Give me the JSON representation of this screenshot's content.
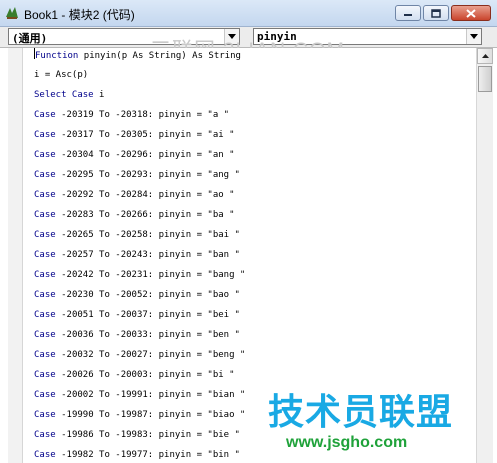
{
  "window": {
    "title": "Book1 - 模块2 (代码)"
  },
  "toolbar": {
    "object_value": "(通用)",
    "procedure_value": "pinyin"
  },
  "watermarks": {
    "top": "三联网 3LIAN.COM",
    "brand_cn": "技术员联盟",
    "brand_url": "www.jsgho.com"
  },
  "code": {
    "lines": [
      {
        "pre": "",
        "kw": "Function",
        "post": " pinyin(p As String) As String"
      },
      {
        "pre": "",
        "kw": "",
        "post": "i = Asc(p)"
      },
      {
        "pre": "",
        "kw": "Select Case",
        "post": " i"
      },
      {
        "pre": "",
        "kw": "Case",
        "post": " -20319 To -20318: pinyin = \"a \""
      },
      {
        "pre": "",
        "kw": "Case",
        "post": " -20317 To -20305: pinyin = \"ai \""
      },
      {
        "pre": "",
        "kw": "Case",
        "post": " -20304 To -20296: pinyin = \"an \""
      },
      {
        "pre": "",
        "kw": "Case",
        "post": " -20295 To -20293: pinyin = \"ang \""
      },
      {
        "pre": "",
        "kw": "Case",
        "post": " -20292 To -20284: pinyin = \"ao \""
      },
      {
        "pre": "",
        "kw": "Case",
        "post": " -20283 To -20266: pinyin = \"ba \""
      },
      {
        "pre": "",
        "kw": "Case",
        "post": " -20265 To -20258: pinyin = \"bai \""
      },
      {
        "pre": "",
        "kw": "Case",
        "post": " -20257 To -20243: pinyin = \"ban \""
      },
      {
        "pre": "",
        "kw": "Case",
        "post": " -20242 To -20231: pinyin = \"bang \""
      },
      {
        "pre": "",
        "kw": "Case",
        "post": " -20230 To -20052: pinyin = \"bao \""
      },
      {
        "pre": "",
        "kw": "Case",
        "post": " -20051 To -20037: pinyin = \"bei \""
      },
      {
        "pre": "",
        "kw": "Case",
        "post": " -20036 To -20033: pinyin = \"ben \""
      },
      {
        "pre": "",
        "kw": "Case",
        "post": " -20032 To -20027: pinyin = \"beng \""
      },
      {
        "pre": "",
        "kw": "Case",
        "post": " -20026 To -20003: pinyin = \"bi \""
      },
      {
        "pre": "",
        "kw": "Case",
        "post": " -20002 To -19991: pinyin = \"bian \""
      },
      {
        "pre": "",
        "kw": "Case",
        "post": " -19990 To -19987: pinyin = \"biao \""
      },
      {
        "pre": "",
        "kw": "Case",
        "post": " -19986 To -19983: pinyin = \"bie \""
      },
      {
        "pre": "",
        "kw": "Case",
        "post": " -19982 To -19977: pinyin = \"bin \""
      }
    ]
  },
  "icons": {
    "title": "vba-module-icon",
    "minimize": "minimize-icon",
    "maximize": "maximize-icon",
    "close": "close-icon",
    "dropdown": "chevron-down-icon"
  },
  "colors": {
    "keyword": "#00008b",
    "text": "#000000",
    "titlebar": "#c4d7ef",
    "close_button": "#c9442c",
    "watermark_blue": "#19a9e4",
    "watermark_green": "#1fa23a"
  }
}
